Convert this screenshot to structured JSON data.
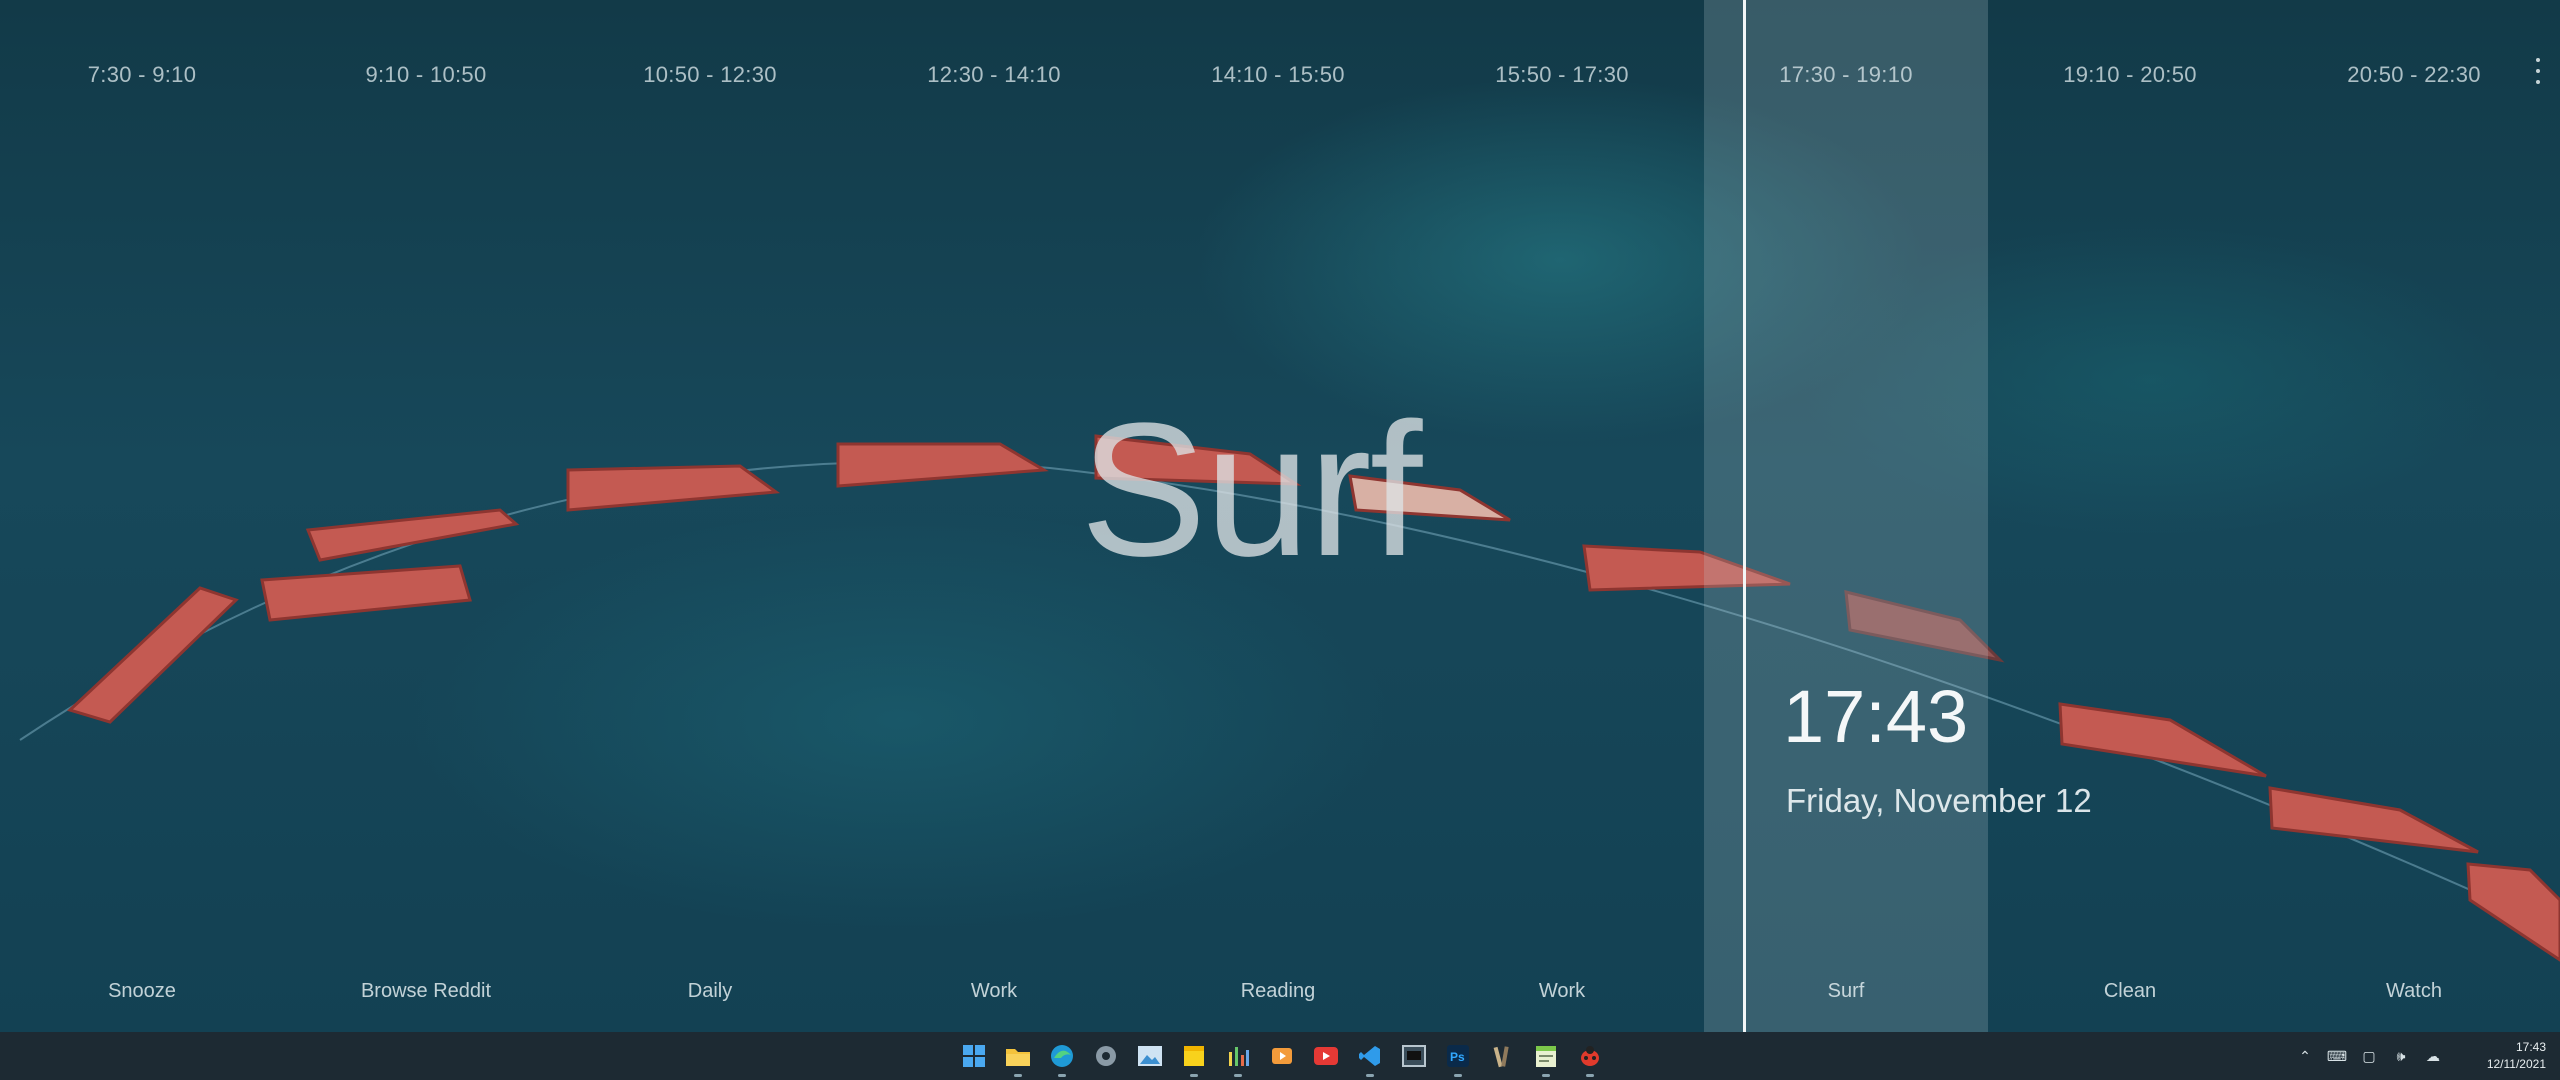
{
  "schedule": [
    {
      "time": "7:30  - 9:10",
      "label": "Snooze"
    },
    {
      "time": "9:10 - 10:50",
      "label": "Browse Reddit"
    },
    {
      "time": "10:50 - 12:30",
      "label": "Daily"
    },
    {
      "time": "12:30 - 14:10",
      "label": "Work"
    },
    {
      "time": "14:10 - 15:50",
      "label": "Reading"
    },
    {
      "time": "15:50 - 17:30",
      "label": "Work"
    },
    {
      "time": "17:30 - 19:10",
      "label": "Surf"
    },
    {
      "time": "19:10 - 20:50",
      "label": "Clean"
    },
    {
      "time": "20:50 - 22:30",
      "label": "Watch"
    }
  ],
  "current": {
    "activity": "Surf",
    "clock": "17:43",
    "date": "Friday, November 12"
  },
  "taskbar": {
    "apps": [
      "windows-start-icon",
      "file-explorer-icon",
      "edge-browser-icon",
      "settings-gear-icon",
      "photos-icon",
      "sticky-notes-icon",
      "equalizer-app-icon",
      "media-player-icon",
      "youtube-icon",
      "vscode-icon",
      "terminal-icon",
      "photoshop-icon",
      "paint-brushes-icon",
      "notepad-icon",
      "ladybug-icon"
    ],
    "time": "17:43",
    "date": "12/11/2021"
  },
  "colors": {
    "wallpaper": "#164556",
    "taskbar": "#1d2a33",
    "boat": "#c2584f"
  }
}
